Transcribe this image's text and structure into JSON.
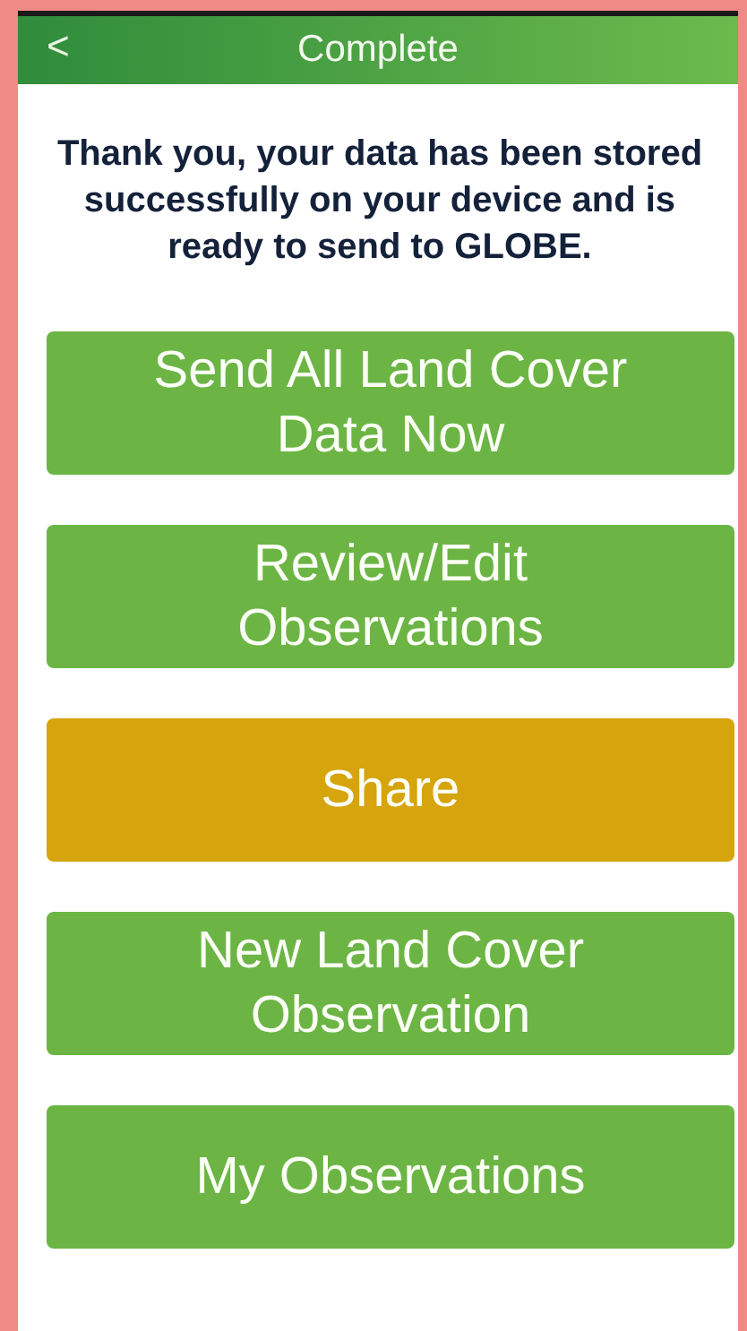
{
  "header": {
    "back": "<",
    "title": "Complete"
  },
  "message": "Thank you, your data has been stored successfully on your device and is ready to send to GLOBE.",
  "buttons": [
    {
      "label": "Send All Land Cover Data Now",
      "kind": "primary"
    },
    {
      "label": "Review/Edit Observations",
      "kind": "primary"
    },
    {
      "label": "Share",
      "kind": "share"
    },
    {
      "label": "New Land Cover Observation",
      "kind": "primary"
    },
    {
      "label": "My Observations",
      "kind": "primary"
    }
  ]
}
